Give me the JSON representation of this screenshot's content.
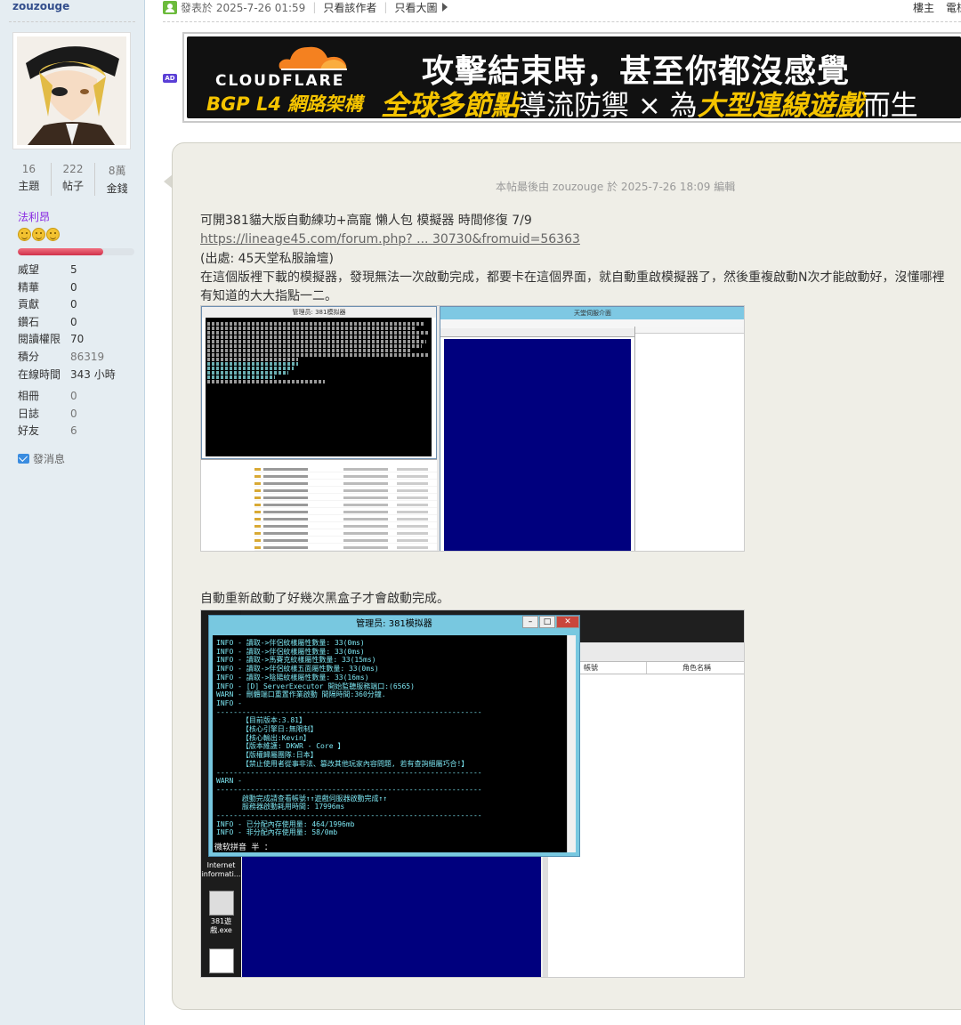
{
  "sidebar": {
    "username": "zouzouge",
    "stats": [
      {
        "num": "16",
        "label": "主題"
      },
      {
        "num": "222",
        "label": "帖子"
      },
      {
        "num": "8萬",
        "label": "金錢"
      }
    ],
    "usergroup": "法利昂",
    "progress_percent": 73,
    "info": [
      {
        "k": "威望",
        "v": "5"
      },
      {
        "k": "精華",
        "v": "0"
      },
      {
        "k": "貢獻",
        "v": "0"
      },
      {
        "k": "鑽石",
        "v": "0"
      },
      {
        "k": "閱讀權限",
        "v": "70"
      },
      {
        "k": "積分",
        "v": "86319"
      },
      {
        "k": "在線時間",
        "v": "343 小時"
      }
    ],
    "info2": [
      {
        "k": "相冊",
        "v": "0"
      },
      {
        "k": "日誌",
        "v": "0"
      },
      {
        "k": "好友",
        "v": "6"
      }
    ],
    "pm_label": "發消息"
  },
  "topbar": {
    "posted": "發表於 2025-7-26 01:59",
    "only_author": "只看該作者",
    "only_images": "只看大圖",
    "floor": "樓主",
    "right_cut": "電梯"
  },
  "ad": {
    "badge": "AD",
    "brand": "CLOUDFLARE",
    "brand_sub": "BGP L4 網路架構",
    "headline": "攻擊結束時，甚至你都沒感覺",
    "sub_a": "全球多節點",
    "sub_b": "導流防禦 × 為",
    "sub_c": "大型連線遊戲",
    "sub_d": "而生"
  },
  "post": {
    "edited": "本帖最後由 zouzouge 於 2025-7-26 18:09 編輯",
    "line1": "可開381貓大版自動練功+高寵 懶人包 模擬器 時間修復 7/9",
    "link": "https://lineage45.com/forum.php? ... 30730&fromuid=56363",
    "line3": "(出處: 45天堂私服論壇)",
    "line4": "在這個版裡下載的模擬器，發現無法一次啟動完成，都要卡在這個界面，就自動重啟模擬器了，然後重複啟動N次才能啟動好，沒懂哪裡",
    "line5": "有知道的大大指點一二。",
    "line6": "自動重新啟動了好幾次黑盒子才會啟動完成。"
  },
  "screenshot1": {
    "cmd_title": "管理员: 381模拟器",
    "server_title": "天堂伺服介面"
  },
  "screenshot2": {
    "cmd_title": "管理员: 381模拟器",
    "col1": "帳號",
    "col2": "角色名稱",
    "desk1": "Internet informati...",
    "desk2": "381遊戲.exe",
    "prompt": "微软拼音 半 ：",
    "terminal": "INFO - 讀取->伴侶紋樣屬性數量: 33(0ms)\nINFO - 讀取->伴侶紋樣屬性數量: 33(0ms)\nINFO - 讀取->馬賽克紋樣屬性數量: 33(15ms)\nINFO - 讀取->伴侶紋樣五面屬性數量: 33(0ms)\nINFO - 讀取->陰陽紋樣屬性數量: 33(16ms)\nINFO - [D] ServerExecutor 開始監聽服務端口:(6565)\nWARN - 刪體端口重置作業啟動 間隔時間:360分鐘.\nINFO -\n--------------------------------------------------------------\n      【目前版本:3.81】\n      【核心引擎日:無限制】\n      【核心輸出:Kevin】\n      【版本維護: DKWR - Core 】\n      【版權歸屬團隊:日本】\n      【禁止使用者從事非法、篡改其他玩家內容問題, 若有查詢絕屬巧合!】\n--------------------------------------------------------------\nWARN -\n--------------------------------------------------------------\n      啟動完成請查看帳號↑↑遊戲伺服器啟動完成↑↑\n      服務器啟動耗用時間: 17996ms\n--------------------------------------------------------------\nINFO - 已分配內存使用量: 464/1996mb\nINFO - 非分配內存使用量: 58/0mb"
  }
}
